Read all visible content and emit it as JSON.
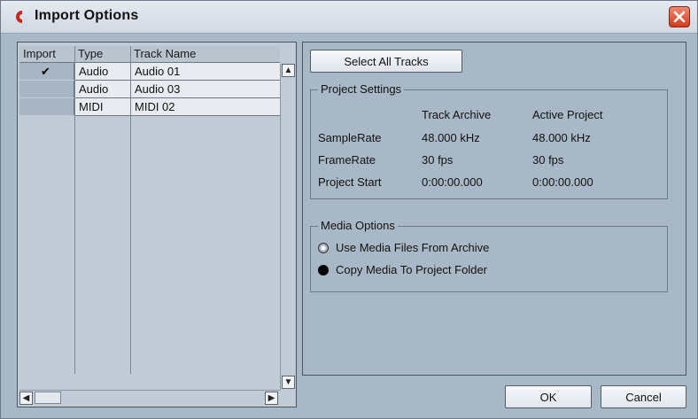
{
  "window": {
    "title": "Import Options"
  },
  "track_table": {
    "columns": [
      "Import",
      "Type",
      "Track Name"
    ],
    "rows": [
      {
        "import": true,
        "type": "Audio",
        "name": "Audio 01"
      },
      {
        "import": false,
        "type": "Audio",
        "name": "Audio 03"
      },
      {
        "import": false,
        "type": "MIDI",
        "name": "MIDI 02"
      }
    ],
    "check_glyph": "✔"
  },
  "actions": {
    "select_all": "Select All Tracks"
  },
  "project_settings": {
    "title": "Project Settings",
    "col_archive": "Track Archive",
    "col_active": "Active Project",
    "rows": [
      {
        "label": "SampleRate",
        "archive": "48.000 kHz",
        "active": "48.000 kHz"
      },
      {
        "label": "FrameRate",
        "archive": "30 fps",
        "active": "30 fps"
      },
      {
        "label": "Project Start",
        "archive": "0:00:00.000",
        "active": "0:00:00.000"
      }
    ]
  },
  "media_options": {
    "title": "Media Options",
    "options": [
      {
        "label": "Use Media Files From Archive",
        "selected": false
      },
      {
        "label": "Copy Media To Project Folder",
        "selected": true
      }
    ]
  },
  "footer": {
    "ok": "OK",
    "cancel": "Cancel"
  },
  "icons": {
    "app": "cubase-logo-icon",
    "close": "close-icon"
  },
  "colors": {
    "dialog_bg": "#a9b8c6",
    "logo": "#c8281e",
    "close": "#d5391c"
  }
}
